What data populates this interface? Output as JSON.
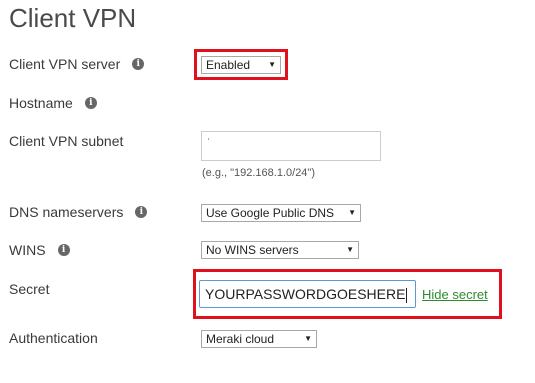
{
  "page": {
    "title": "Client VPN"
  },
  "client_vpn_server": {
    "label": "Client VPN server",
    "value": "Enabled"
  },
  "hostname": {
    "label": "Hostname"
  },
  "client_vpn_subnet": {
    "label": "Client VPN subnet",
    "value": "",
    "hint": "(e.g., \"192.168.1.0/24\")"
  },
  "dns_nameservers": {
    "label": "DNS nameservers",
    "value": "Use Google Public DNS"
  },
  "wins": {
    "label": "WINS",
    "value": "No WINS servers"
  },
  "secret": {
    "label": "Secret",
    "value": "YOURPASSWORDGOESHERE",
    "toggle_label": "Hide secret"
  },
  "authentication": {
    "label": "Authentication",
    "value": "Meraki cloud"
  },
  "icons": {
    "info": "info-icon",
    "dropdown": "chevron-down-icon"
  },
  "colors": {
    "highlight": "#e0101c",
    "link": "#2e8b2e",
    "focus_border": "#5b9bd5"
  }
}
